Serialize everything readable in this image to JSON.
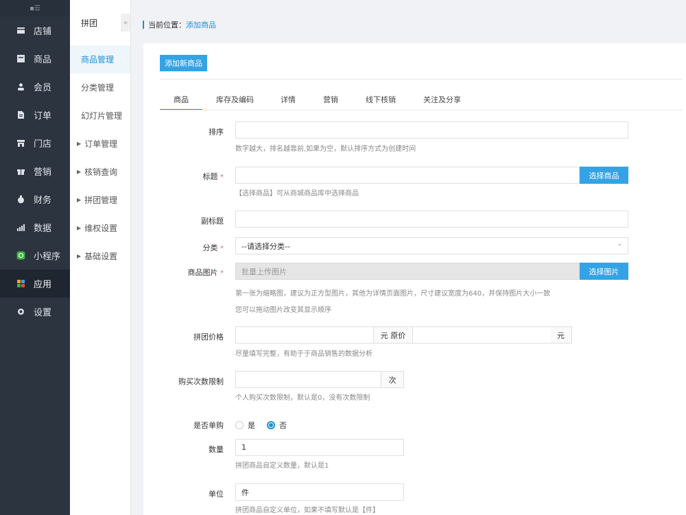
{
  "sidebar": {
    "collapse_icon": "menu-icon",
    "items": [
      {
        "label": "店铺",
        "icon": "shop-icon"
      },
      {
        "label": "商品",
        "icon": "goods-icon"
      },
      {
        "label": "会员",
        "icon": "user-icon"
      },
      {
        "label": "订单",
        "icon": "order-icon"
      },
      {
        "label": "门店",
        "icon": "store-icon"
      },
      {
        "label": "营销",
        "icon": "gift-icon"
      },
      {
        "label": "财务",
        "icon": "money-bag-icon"
      },
      {
        "label": "数据",
        "icon": "chart-icon"
      },
      {
        "label": "小程序",
        "icon": "miniprogram-icon"
      },
      {
        "label": "应用",
        "icon": "apps-icon"
      },
      {
        "label": "设置",
        "icon": "gear-icon"
      }
    ],
    "active_index": 9
  },
  "submenu": {
    "title": "拼团",
    "fold_icon": "«",
    "items": [
      {
        "label": "商品管理",
        "group": false
      },
      {
        "label": "分类管理",
        "group": false
      },
      {
        "label": "幻灯片管理",
        "group": false
      },
      {
        "label": "订单管理",
        "group": true
      },
      {
        "label": "核销查询",
        "group": true
      },
      {
        "label": "拼团管理",
        "group": true
      },
      {
        "label": "维权设置",
        "group": true
      },
      {
        "label": "基础设置",
        "group": true
      }
    ]
  },
  "breadcrumb": {
    "label": "当前位置：",
    "current": "添加商品"
  },
  "main": {
    "add_button": "添加新商品",
    "tabs": [
      "商品",
      "库存及编码",
      "详情",
      "营销",
      "线下核销",
      "关注及分享"
    ],
    "form": {
      "sort": {
        "label": "排序",
        "value": "",
        "help": "数字越大，排名越靠前,如果为空，默认排序方式为创建时间"
      },
      "title": {
        "label": "标题",
        "required": "*",
        "value": "",
        "button": "选择商品",
        "help": "【选择商品】可从商城商品库中选择商品"
      },
      "subtitle": {
        "label": "副标题",
        "value": ""
      },
      "category": {
        "label": "分类",
        "required": "*",
        "selected": "--请选择分类--",
        "chevron": "⌄"
      },
      "images": {
        "label": "商品图片",
        "required": "*",
        "placeholder": "批量上传图片",
        "button": "选择图片",
        "help1": "第一张为缩略图，建议为正方型图片，其他为详情页面图片，尺寸建议宽度为640，并保持图片大小一致",
        "help2": "您可以拖动图片改变其显示顺序"
      },
      "price": {
        "label": "拼团价格",
        "value": "",
        "unit1": "元 原价",
        "orig_value": "",
        "unit2": "元",
        "help": "尽量填写完整，有助于于商品销售的数据分析"
      },
      "limit": {
        "label": "购买次数限制",
        "value": "",
        "unit": "次",
        "help": "个人购买次数限制，默认是0，没有次数限制"
      },
      "single": {
        "label": "是否单购",
        "yes": "是",
        "no": "否",
        "selected": "否"
      },
      "quantity": {
        "label": "数量",
        "value": "1",
        "help": "拼团商品自定义数量，默认是1"
      },
      "unit": {
        "label": "单位",
        "value": "件",
        "help": "拼团商品自定义单位，如果不填写默认是【件】"
      }
    }
  }
}
